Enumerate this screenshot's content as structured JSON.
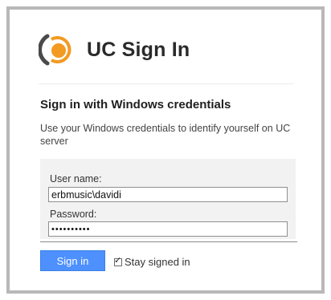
{
  "header": {
    "title": "UC Sign In",
    "logo_icon": "uc-logo-icon",
    "logo_colors": {
      "ring": "#f29a22",
      "dot": "#f29a22",
      "arc": "#4a4a4a"
    }
  },
  "panel": {
    "heading": "Sign in with Windows credentials",
    "description": "Use your Windows credentials to identify yourself on UC server"
  },
  "form": {
    "username_label": "User name:",
    "username_value": "erbmusic\\davidi",
    "password_label": "Password:",
    "password_value": "••••••••••"
  },
  "actions": {
    "signin_label": "Sign in",
    "signin_color": "#4d90fe",
    "stay_signed_in_label": "Stay signed in",
    "stay_signed_in_checked": true,
    "check_glyph": "✓"
  }
}
